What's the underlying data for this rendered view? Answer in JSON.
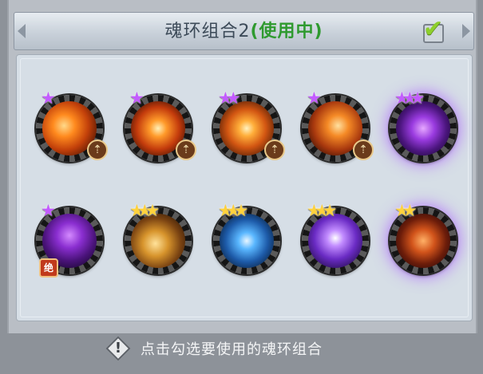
{
  "header": {
    "title": "魂环组合2",
    "status": "(使用中)",
    "checked": true,
    "check_icon": "checkmark-icon"
  },
  "colors": {
    "status_green": "#2f9a2f",
    "star_purple": "#c35bff",
    "star_gold": "#ffd23c",
    "check_green": "#8ecf2c"
  },
  "skills": [
    {
      "row": 1,
      "col": 1,
      "stars": 1,
      "star_color": "purple",
      "badge": "upgrade-arrow-icon",
      "art": "fire-slash"
    },
    {
      "row": 1,
      "col": 2,
      "stars": 1,
      "star_color": "purple",
      "badge": "upgrade-arrow-icon",
      "art": "fire-cross"
    },
    {
      "row": 1,
      "col": 3,
      "stars": 2,
      "star_color": "purple",
      "badge": "upgrade-arrow-icon",
      "art": "fire-sword"
    },
    {
      "row": 1,
      "col": 4,
      "stars": 1,
      "star_color": "purple",
      "badge": "upgrade-arrow-icon",
      "art": "fire-blade"
    },
    {
      "row": 1,
      "col": 5,
      "stars": 3,
      "star_color": "purple",
      "badge": "",
      "art": "purple-beast",
      "glow": true
    },
    {
      "row": 2,
      "col": 1,
      "stars": 1,
      "star_color": "purple",
      "badge": "绝",
      "art": "purple-claws"
    },
    {
      "row": 2,
      "col": 2,
      "stars": 3,
      "star_color": "gold",
      "badge": "",
      "art": "gold-fist"
    },
    {
      "row": 2,
      "col": 3,
      "stars": 3,
      "star_color": "gold",
      "badge": "",
      "art": "blue-claw"
    },
    {
      "row": 2,
      "col": 4,
      "stars": 3,
      "star_color": "gold",
      "badge": "",
      "art": "purple-lightning"
    },
    {
      "row": 2,
      "col": 5,
      "stars": 2,
      "star_color": "gold",
      "badge": "",
      "art": "fire-demon",
      "glow": true
    }
  ],
  "footer": {
    "hint_icon": "warning-diamond-icon",
    "hint": "点击勾选要使用的魂环组合"
  }
}
